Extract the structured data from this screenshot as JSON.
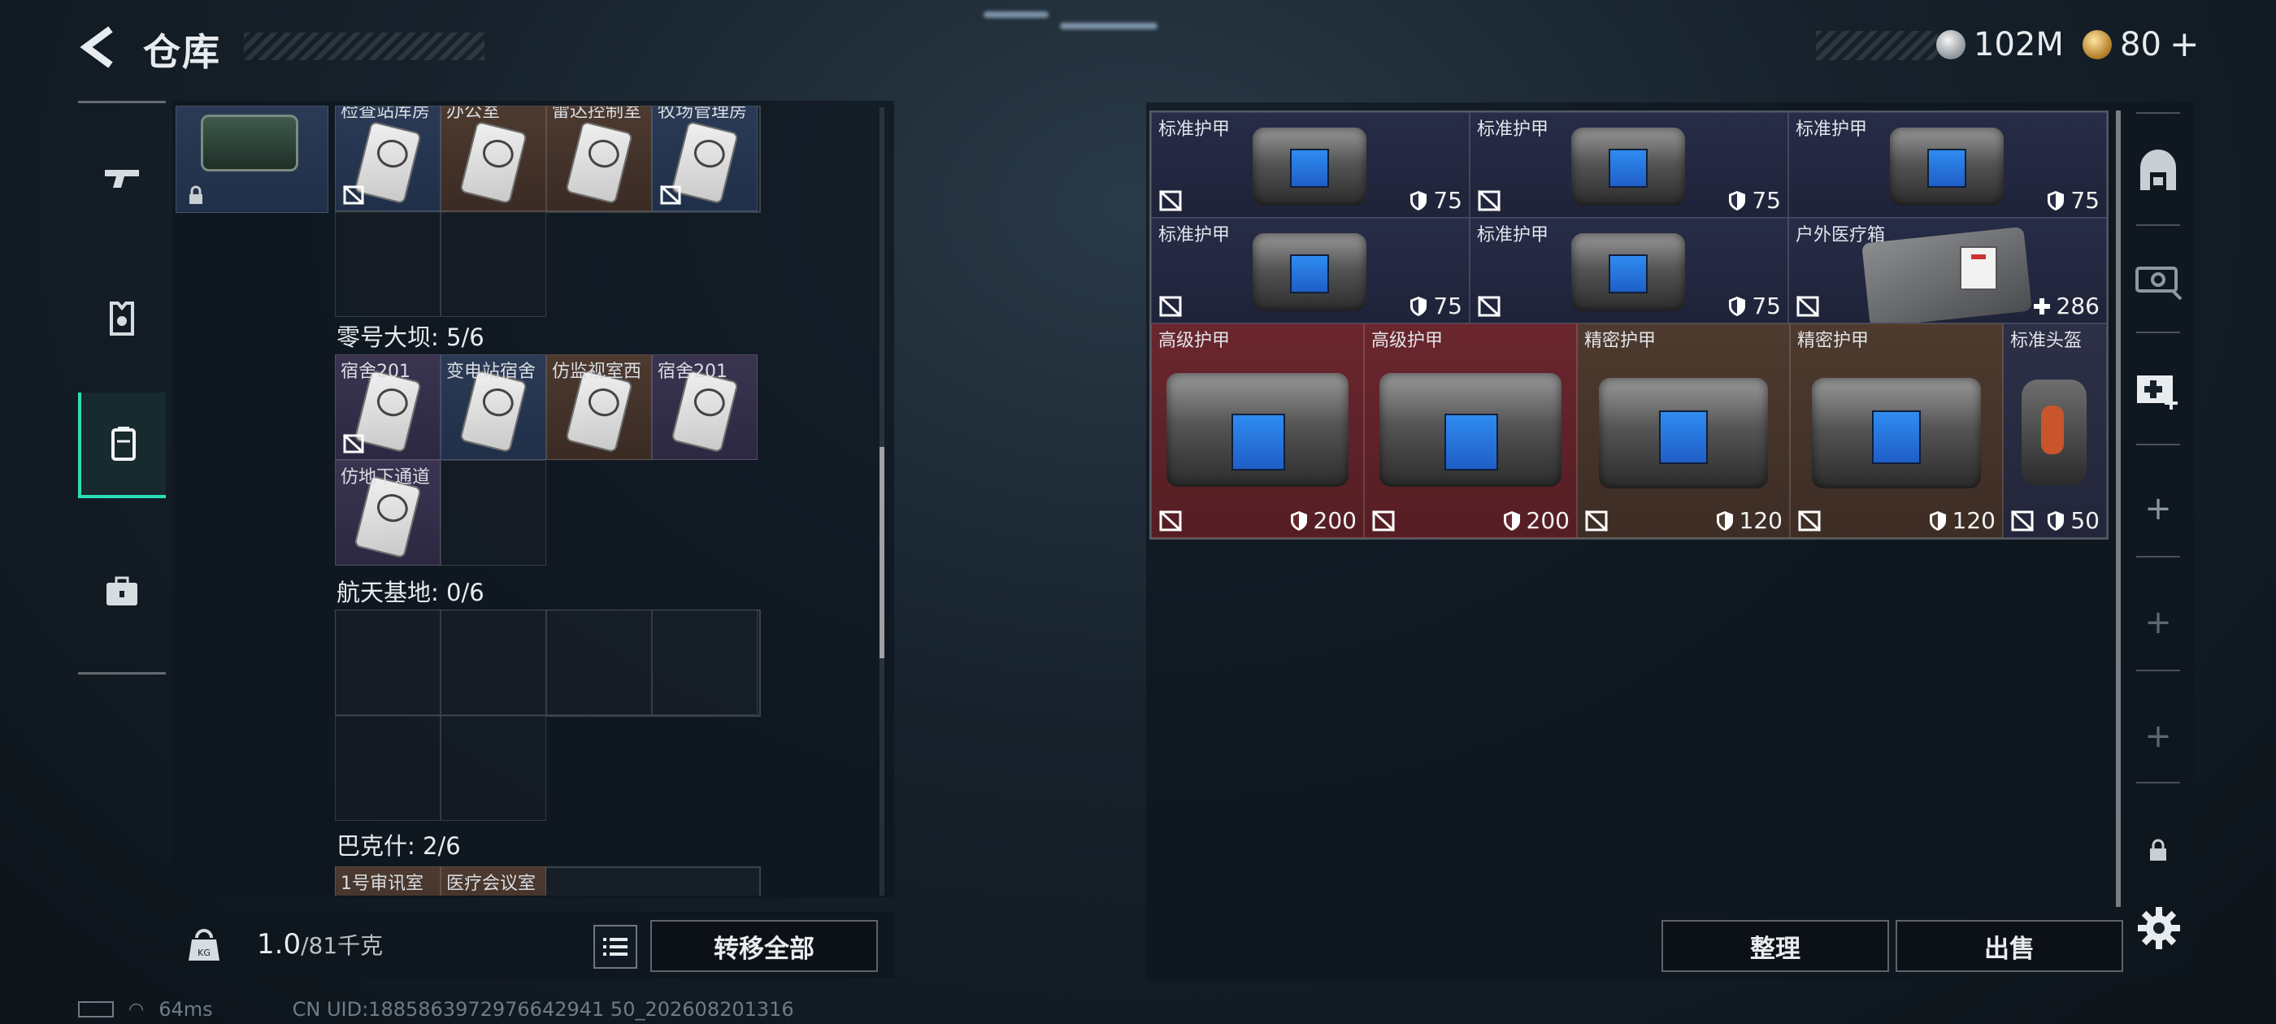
{
  "header": {
    "title": "仓库",
    "currency": [
      {
        "icon": "silver-coin-icon",
        "value": "102M"
      },
      {
        "icon": "gold-coin-icon",
        "value": "80"
      }
    ],
    "add_symbol": "+"
  },
  "left_nav": {
    "items": [
      {
        "id": "weapons",
        "icon": "gun-icon",
        "active": false
      },
      {
        "id": "armor",
        "icon": "armor-vest-icon",
        "active": false
      },
      {
        "id": "keycards",
        "icon": "keycard-holder-icon",
        "active": true
      },
      {
        "id": "supplies",
        "icon": "toolbox-icon",
        "active": false
      }
    ]
  },
  "key_storage": {
    "top_row": {
      "cells": [
        {
          "label": "检查站库房",
          "color": "blue"
        },
        {
          "label": "办公室",
          "color": "brown"
        },
        {
          "label": "雷达控制室",
          "color": "brown"
        },
        {
          "label": "牧场管理房",
          "color": "blue"
        }
      ]
    },
    "sections": [
      {
        "name": "零号大坝: 5/6",
        "cells": [
          {
            "label": "宿舍201",
            "color": "purple"
          },
          {
            "label": "变电站宿舍",
            "color": "blue"
          },
          {
            "label": "仿监视室西",
            "color": "brown"
          },
          {
            "label": "宿舍201",
            "color": "purple"
          },
          {
            "label": "仿地下通道",
            "color": "purple"
          }
        ]
      },
      {
        "name": "航天基地: 0/6",
        "cells": []
      },
      {
        "name": "巴克什: 2/6",
        "cells": [
          {
            "label": "1号审讯室",
            "color": "brown"
          },
          {
            "label": "医疗会议室",
            "color": "brown"
          }
        ]
      }
    ]
  },
  "capacity": {
    "current": "1.0",
    "max": "/81千克"
  },
  "buttons": {
    "transfer_all": "转移全部",
    "sort": "整理",
    "sell": "出售"
  },
  "footer": {
    "ping": "64ms",
    "uid": "CN UID:1885863972976642941 50_202608201316"
  },
  "inventory": {
    "items": [
      {
        "name": "标准护甲",
        "value": "75",
        "stat_icon": "shield-icon",
        "rarity": "standard"
      },
      {
        "name": "标准护甲",
        "value": "75",
        "stat_icon": "shield-icon",
        "rarity": "standard"
      },
      {
        "name": "标准护甲",
        "value": "75",
        "stat_icon": "shield-icon",
        "rarity": "standard"
      },
      {
        "name": "标准护甲",
        "value": "75",
        "stat_icon": "shield-icon",
        "rarity": "standard"
      },
      {
        "name": "标准护甲",
        "value": "75",
        "stat_icon": "shield-icon",
        "rarity": "standard"
      },
      {
        "name": "户外医疗箱",
        "value": "286",
        "stat_icon": "plus-icon",
        "rarity": "standard"
      },
      {
        "name": "高级护甲",
        "value": "200",
        "stat_icon": "shield-icon",
        "rarity": "advanced"
      },
      {
        "name": "高级护甲",
        "value": "200",
        "stat_icon": "shield-icon",
        "rarity": "advanced"
      },
      {
        "name": "精密护甲",
        "value": "120",
        "stat_icon": "shield-icon",
        "rarity": "precision"
      },
      {
        "name": "精密护甲",
        "value": "120",
        "stat_icon": "shield-icon",
        "rarity": "precision"
      },
      {
        "name": "标准头盔",
        "value": "50",
        "stat_icon": "shield-icon",
        "rarity": "standard"
      }
    ]
  },
  "right_sidebar": {
    "items": [
      {
        "icon": "armor-slot-icon"
      },
      {
        "icon": "weapon-case-icon"
      },
      {
        "icon": "medical-case-icon"
      },
      {
        "icon": "add-slot-icon",
        "symbol": "+"
      },
      {
        "icon": "add-slot-icon",
        "symbol": "+"
      },
      {
        "icon": "add-slot-icon",
        "symbol": "+"
      },
      {
        "icon": "lock-icon"
      }
    ]
  },
  "colors": {
    "accent": "#2be0b8",
    "standard_bg": "#272c47",
    "advanced_bg": "#6a262d",
    "precision_bg": "#4e3a2e"
  }
}
